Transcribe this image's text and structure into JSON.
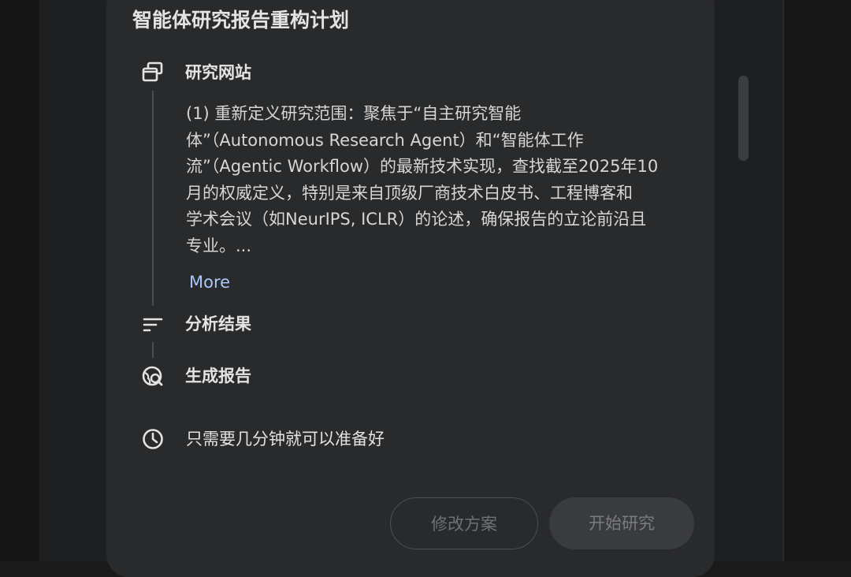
{
  "plan": {
    "title": "智能体研究报告重构计划",
    "steps": [
      {
        "label": "研究网站",
        "icon": "browser-windows-icon"
      },
      {
        "label": "分析结果",
        "icon": "sort-lines-icon"
      },
      {
        "label": "生成报告",
        "icon": "globe-search-icon"
      }
    ],
    "description_lines": [
      "(1) 重新定义研究范围：聚焦于“自主研究智能",
      "体”（Autonomous Research Agent）和“智能体工作",
      "流”（Agentic Workflow）的最新技术实现，查找截至2025年10",
      "月的权威定义，特别是来自顶级厂商技术白皮书、工程博客和",
      "学术会议（如NeurIPS, ICLR）的论述，确保报告的立论前沿且",
      "专业。..."
    ],
    "more_label": "More",
    "time_estimate": {
      "text": "只需要几分钟就可以准备好",
      "icon": "clock-icon"
    }
  },
  "actions": {
    "edit_label": "修改方案",
    "start_label": "开始研究"
  },
  "colors": {
    "card_bg": "#282a2c",
    "page_bg": "#1e1f20",
    "link": "#a8c7fa",
    "text": "#e3e3e3"
  }
}
